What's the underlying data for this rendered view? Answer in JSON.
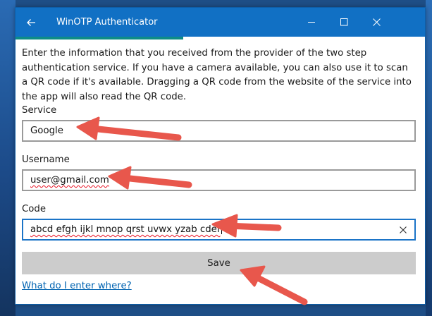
{
  "window": {
    "title": "WinOTP Authenticator",
    "accent_color": "#1170c4",
    "progress_color": "#0e8c86",
    "progress_fraction": 0.41
  },
  "icons": {
    "back": "back-arrow-icon",
    "minimize": "minimize-icon",
    "maximize": "maximize-icon",
    "close": "close-icon",
    "clear": "clear-icon"
  },
  "form": {
    "description": "Enter the information that you received from the provider of the two step authentication service. If you have a camera available, you can also use it to scan a QR code if it's available. Dragging a QR code from the website of the service into the app will also read the QR code.",
    "service": {
      "label": "Service",
      "value": "Google"
    },
    "username": {
      "label": "Username",
      "value": "user@gmail.com"
    },
    "code": {
      "label": "Code",
      "value": "abcd efgh ijkl mnop qrst uvwx yzab cdef"
    },
    "save_label": "Save",
    "help_link": "What do I enter where?"
  },
  "annotations": {
    "arrow_color": "#e8574c",
    "count": 4
  }
}
